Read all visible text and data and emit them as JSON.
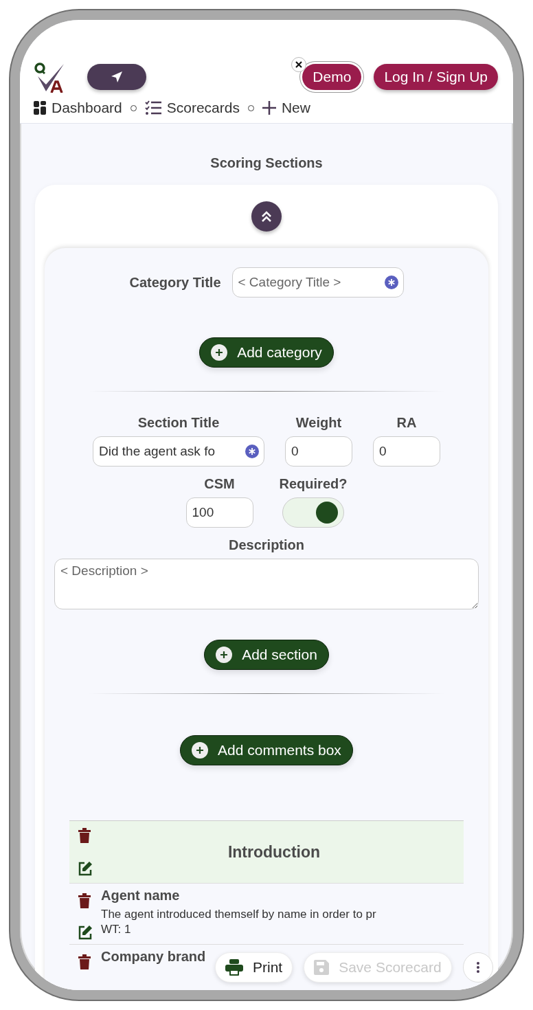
{
  "header": {
    "demo": {
      "label": "Demo"
    },
    "login": {
      "label": "Log In / Sign Up"
    },
    "nav": [
      {
        "label": "Dashboard"
      },
      {
        "label": "Scorecards"
      },
      {
        "label": "New"
      }
    ]
  },
  "page_title": "Scoring Sections",
  "form": {
    "category_title": {
      "label": "Category Title",
      "placeholder": "< Category Title >"
    },
    "add_category": "Add category",
    "section_title": {
      "label": "Section Title",
      "value": "Did the agent ask fo"
    },
    "weight": {
      "label": "Weight",
      "value": "0"
    },
    "ra": {
      "label": "RA",
      "value": "0"
    },
    "csm": {
      "label": "CSM",
      "value": "100"
    },
    "required": {
      "label": "Required?",
      "on": true
    },
    "description": {
      "label": "Description",
      "placeholder": "< Description >"
    },
    "add_section": "Add section",
    "add_comments": "Add comments box"
  },
  "rows": [
    {
      "kind": "category",
      "title": "Introduction"
    },
    {
      "kind": "item",
      "title": "Agent name",
      "description": "The agent introduced themself by name in order to pr",
      "weight": "WT: 1"
    },
    {
      "kind": "item",
      "title": "Company brand"
    }
  ],
  "floating": {
    "print": "Print",
    "save": {
      "label": "Save Scorecard",
      "disabled": true
    }
  }
}
